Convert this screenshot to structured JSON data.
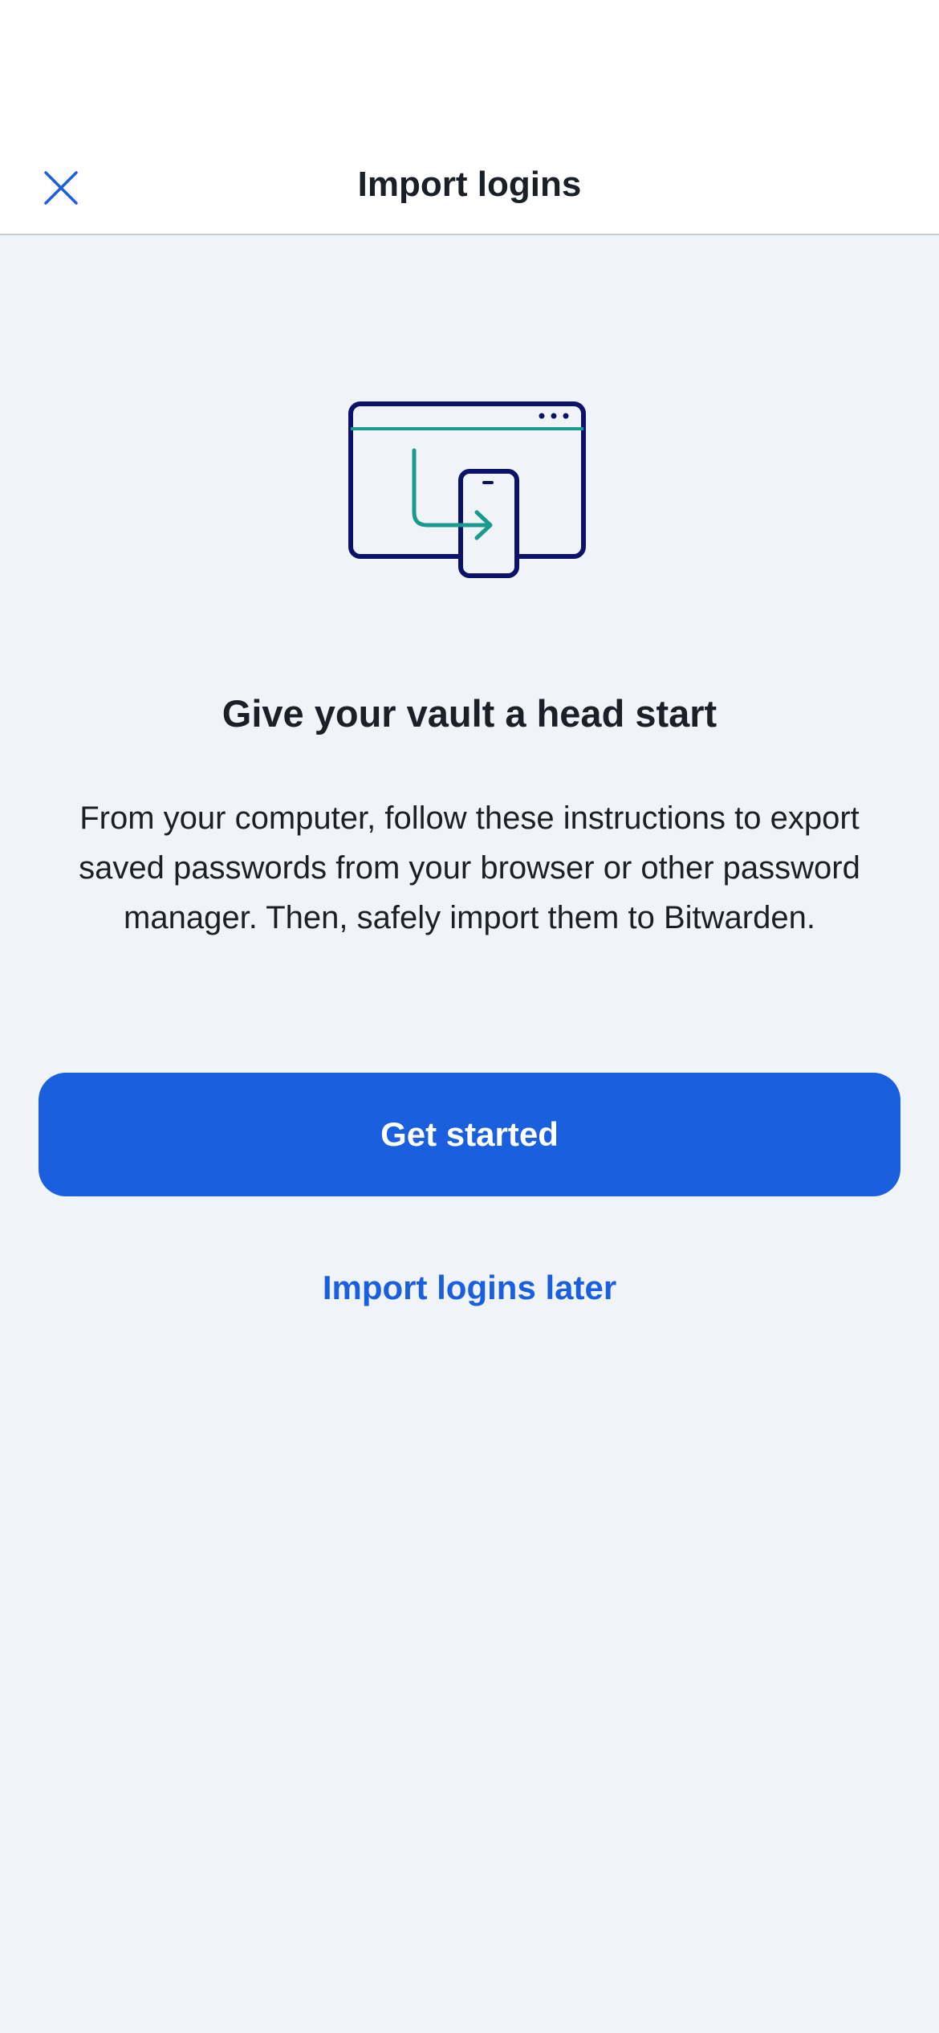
{
  "header": {
    "title": "Import logins",
    "close_icon": "close-icon"
  },
  "illustration": {
    "icon": "import-devices-illustration",
    "colors": {
      "outline": "#0c1267",
      "accent": "#1a9a8f"
    }
  },
  "content": {
    "headline": "Give your vault a head start",
    "body": "From your computer, follow these instructions to export saved passwords from your browser or other password manager. Then, safely import them to Bitwarden."
  },
  "actions": {
    "primary_label": "Get started",
    "secondary_label": "Import logins later"
  },
  "theme": {
    "accent": "#1a5fde",
    "background": "#f0f3f7"
  }
}
